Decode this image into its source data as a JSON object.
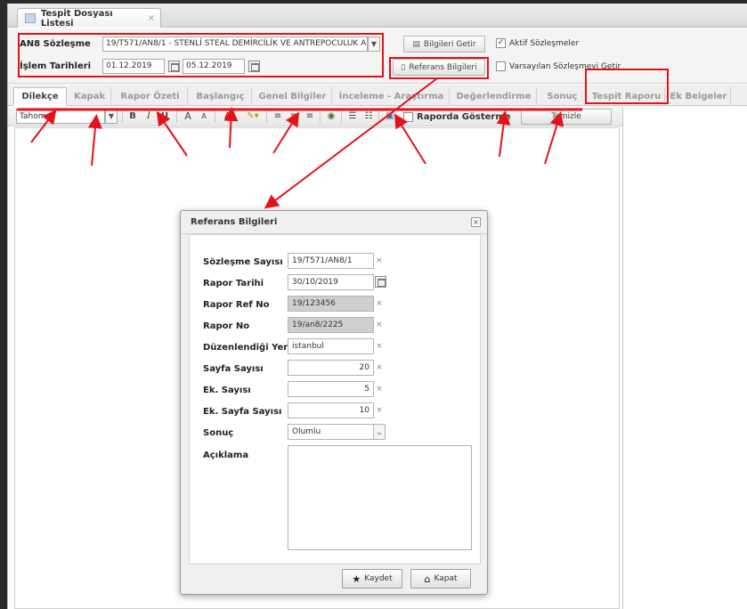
{
  "window_tab": {
    "title": "Tespit Dosyası Listesi",
    "close": "×"
  },
  "form": {
    "contract_label": "AN8 Sözleşme",
    "contract_value": "19/T571/AN8/1 - STENLİ STEAL DEMİRCİLİK VE ANTREPOCULUK A.",
    "dates_label": "İşlem Tarihleri",
    "date_from": "01.12.2019",
    "date_to": "05.12.2019",
    "get_info_button": "Bilgileri Getir",
    "reference_button": "Referans Bilgileri",
    "active_contracts_label": "Aktif Sözleşmeler",
    "active_contracts_checked": true,
    "default_contract_label": "Varsayılan Sözleşmeyi Getir",
    "default_contract_checked": false
  },
  "tabs": [
    {
      "label": "Dilekçe",
      "active": true
    },
    {
      "label": "Kapak"
    },
    {
      "label": "Rapor Özeti"
    },
    {
      "label": "Başlangıç"
    },
    {
      "label": "Genel Bilgiler"
    },
    {
      "label": "İnceleme - Araştırma"
    },
    {
      "label": "Değerlendirme"
    },
    {
      "label": "Sonuç"
    },
    {
      "label": "Tespit Raporu"
    },
    {
      "label": "Ek Belgeler"
    }
  ],
  "toolbar": {
    "font": "Tahoma",
    "bold": "B",
    "italic": "I",
    "underline": "U",
    "grow_font": "A",
    "shrink_font": "A",
    "hide_in_report_label": "Raporda Gösterme",
    "clear_button": "Temizle"
  },
  "modal": {
    "title": "Referans Bilgileri",
    "close": "×",
    "fields": [
      {
        "label": "Sözleşme Sayısı",
        "value": "19/T571/AN8/1"
      },
      {
        "label": "Rapor Tarihi",
        "value": "30/10/2019"
      },
      {
        "label": "Rapor Ref No",
        "value": "19/123456"
      },
      {
        "label": "Rapor No",
        "value": "19/an8/2225"
      },
      {
        "label": "Düzenlendiği Yer",
        "value": "istanbul"
      },
      {
        "label": "Sayfa Sayısı",
        "value": "20"
      },
      {
        "label": "Ek. Sayısı",
        "value": "5"
      },
      {
        "label": "Ek. Sayfa Sayısı",
        "value": "10"
      },
      {
        "label": "Sonuç",
        "value": "Olumlu"
      },
      {
        "label": "Açıklama",
        "value": ""
      }
    ],
    "clear_x": "×",
    "save_button": "Kaydet",
    "close_button": "Kapat"
  },
  "colors": {
    "highlight": "#e5121b"
  },
  "icons": {
    "save": "star-icon",
    "close": "home-icon",
    "calendar": "calendar-icon",
    "dropdown": "chevron-down-icon"
  }
}
